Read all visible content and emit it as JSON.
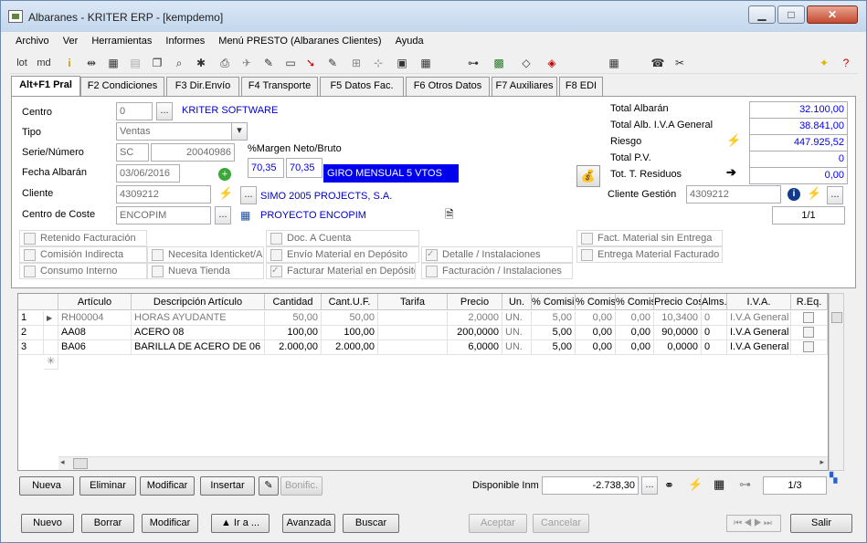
{
  "window": {
    "title": "Albaranes - KRITER ERP -  [kempdemo]",
    "minimize": "▁",
    "maximize": "□",
    "close": "✕"
  },
  "menu": [
    "Archivo",
    "Ver",
    "Herramientas",
    "Informes",
    "Menú PRESTO (Albaranes Clientes)",
    "Ayuda"
  ],
  "toolbar": {
    "lot": "lot",
    "md": "md"
  },
  "tabs": [
    "Alt+F1 Pral",
    "F2 Condiciones",
    "F3 Dir.Envío",
    "F4 Transporte",
    "F5 Datos Fac.",
    "F6 Otros Datos",
    "F7 Auxiliares",
    "F8 EDI"
  ],
  "header": {
    "centro_label": "Centro",
    "centro_value": "0",
    "centro_name": "KRITER SOFTWARE",
    "tipo_label": "Tipo",
    "tipo_value": "Ventas",
    "serie_label": "Serie/Número",
    "serie_value": "SC",
    "numero_value": "20040986",
    "fecha_label": "Fecha Albarán",
    "fecha_value": "03/06/2016",
    "cliente_label": "Cliente",
    "cliente_value": "4309212",
    "cliente_name": "SIMO 2005 PROJECTS, S.A.",
    "coste_label": "Centro de Coste",
    "coste_value": "ENCOPIM",
    "coste_name": "PROYECTO ENCOPIM",
    "margen_label": "%Margen Neto/Bruto",
    "margen_neto": "70,35",
    "margen_bruto": "70,35",
    "forma_pago": "GIRO MENSUAL 5 VTOS",
    "ellipsis": "...",
    "dropdown_arrow": "▾"
  },
  "totals": [
    {
      "label": "Total Albarán",
      "value": "32.100,00"
    },
    {
      "label": "Total Alb. I.V.A General",
      "value": "38.841,00"
    },
    {
      "label": "Riesgo",
      "value": "447.925,52"
    },
    {
      "label": "Total P.V.",
      "value": "0"
    },
    {
      "label": "Tot. T. Residuos",
      "value": "0,00"
    }
  ],
  "cliente_gestion": {
    "label": "Cliente Gestión",
    "value": "4309212",
    "pager": "1/1"
  },
  "checkboxes": [
    {
      "label": "Retenido Facturación",
      "checked": false
    },
    {
      "label": "Comisión Indirecta",
      "checked": false
    },
    {
      "label": "Consumo Interno",
      "checked": false
    },
    {
      "label": "Necesita Identicket/A",
      "checked": false
    },
    {
      "label": "Nueva Tienda",
      "checked": false
    },
    {
      "label": "Doc. A Cuenta",
      "checked": false
    },
    {
      "label": "Envío Material en Depósito",
      "checked": false
    },
    {
      "label": "Facturar Material en Depósito",
      "checked": true
    },
    {
      "label": "Detalle / Instalaciones",
      "checked": true
    },
    {
      "label": "Facturación / Instalaciones",
      "checked": false
    },
    {
      "label": "Fact. Material sin Entrega",
      "checked": false
    },
    {
      "label": "Entrega Material Facturado",
      "checked": false
    }
  ],
  "grid": {
    "columns": [
      "Artículo",
      "Descripción Artículo",
      "Cantidad",
      "Cant.U.F.",
      "Tarifa",
      "Precio",
      "Un.",
      "% Comisió",
      "% Comis.",
      "% Comis.",
      "Precio Cost",
      "Alms.",
      "I.V.A.",
      "R.Eq."
    ],
    "rows": [
      {
        "num": "1",
        "articulo": "RH00004",
        "descripcion": "HORAS AYUDANTE",
        "cantidad": "50,00",
        "cant_uf": "50,00",
        "tarifa": "",
        "precio": "2,0000",
        "un": "UN.",
        "com1": "5,00",
        "com2": "0,00",
        "com3": "0,00",
        "coste": "10,3400",
        "alms": "0",
        "iva": "I.V.A General"
      },
      {
        "num": "2",
        "articulo": "AA08",
        "descripcion": "ACERO 08",
        "cantidad": "100,00",
        "cant_uf": "100,00",
        "tarifa": "",
        "precio": "200,0000",
        "un": "UN.",
        "com1": "5,00",
        "com2": "0,00",
        "com3": "0,00",
        "coste": "90,0000",
        "alms": "0",
        "iva": "I.V.A General"
      },
      {
        "num": "3",
        "articulo": "BA06",
        "descripcion": "BARILLA DE ACERO DE 06",
        "cantidad": "2.000,00",
        "cant_uf": "2.000,00",
        "tarifa": "",
        "precio": "6,0000",
        "un": "UN.",
        "com1": "5,00",
        "com2": "0,00",
        "com3": "0,00",
        "coste": "0,0000",
        "alms": "0",
        "iva": "I.V.A General"
      }
    ]
  },
  "line_buttons": {
    "nueva": "Nueva",
    "eliminar": "Eliminar",
    "modificar": "Modificar",
    "insertar": "Insertar",
    "bonific": "Bonific.",
    "disponible_label": "Disponible Inmed",
    "disponible_value": "-2.738,30",
    "pager": "1/3"
  },
  "bottom_buttons": {
    "nuevo": "Nuevo",
    "borrar": "Borrar",
    "modificar": "Modificar",
    "ira": "▲ Ir a ...",
    "avanzada": "Avanzada",
    "buscar": "Buscar",
    "aceptar": "Aceptar",
    "cancelar": "Cancelar",
    "salir": "Salir"
  }
}
